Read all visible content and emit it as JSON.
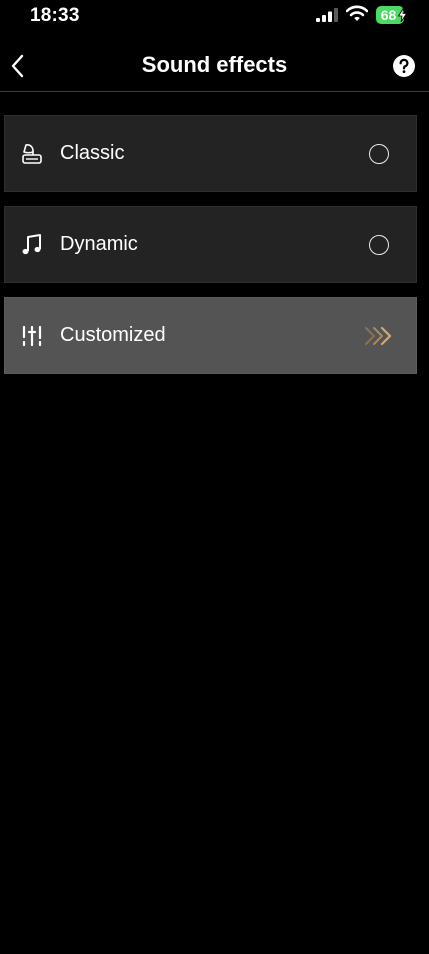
{
  "status_bar": {
    "time": "18:33",
    "battery_level": "68",
    "icons": [
      "signal-icon",
      "wifi-icon",
      "battery-icon",
      "charging-bolt-icon"
    ]
  },
  "header": {
    "title": "Sound effects",
    "back_icon": "chevron-left-icon",
    "help_icon": "question-mark-icon"
  },
  "effects": [
    {
      "label": "Classic",
      "icon": "gramophone-icon",
      "control": "radio-unchecked"
    },
    {
      "label": "Dynamic",
      "icon": "music-note-icon",
      "control": "radio-unchecked"
    },
    {
      "label": "Customized",
      "icon": "equalizer-sliders-icon",
      "control": "chevrons-right-icon",
      "selected": true
    }
  ],
  "colors": {
    "background": "#000000",
    "row_background": "#232323",
    "selected_row_background": "#545454",
    "accent_gold": "#c9a06a",
    "battery_green": "#4cd964"
  }
}
